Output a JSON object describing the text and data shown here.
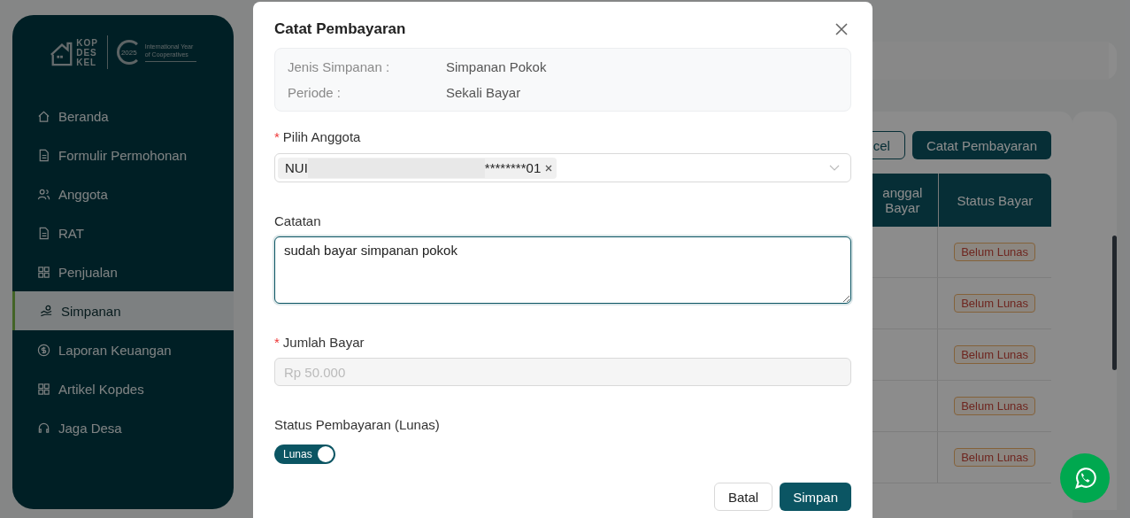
{
  "sidebar": {
    "logo": {
      "brand_lines": [
        "KOP",
        "DES",
        "KEL"
      ],
      "year": "2025",
      "caption": "International Year of Cooperatives"
    },
    "items": [
      {
        "label": "Beranda",
        "kind": "home",
        "selected": false
      },
      {
        "label": "Formulir Permohonan",
        "kind": "doc",
        "selected": false
      },
      {
        "label": "Anggota",
        "kind": "people",
        "selected": false
      },
      {
        "label": "RAT",
        "kind": "doc",
        "selected": false
      },
      {
        "label": "Penjualan",
        "kind": "grid",
        "selected": false
      },
      {
        "label": "Simpanan",
        "kind": "savings",
        "selected": true
      },
      {
        "label": "Laporan Keuangan",
        "kind": "dollar",
        "selected": false
      },
      {
        "label": "Artikel Kopdes",
        "kind": "grid",
        "selected": false
      },
      {
        "label": "Jaga Desa",
        "kind": "headset",
        "selected": false
      }
    ]
  },
  "toolbar": {
    "buttons": [
      {
        "label": "cel",
        "kind": "outline"
      },
      {
        "label": "Catat Pembayaran",
        "kind": "primary"
      }
    ]
  },
  "table": {
    "columns": [
      "anggal Bayar",
      "Status Bayar"
    ],
    "rows": [
      {
        "status": "Belum Lunas"
      },
      {
        "status": "Belum Lunas"
      },
      {
        "status": "Belum Lunas"
      },
      {
        "status": "Belum Lunas"
      },
      {
        "status": "Belum Lunas"
      }
    ]
  },
  "modal": {
    "title": "Catat Pembayaran",
    "info": [
      {
        "label": "Jenis Simpanan :",
        "value": "Simpanan Pokok"
      },
      {
        "label": "Periode :",
        "value": "Sekali Bayar"
      }
    ],
    "member": {
      "label": "Pilih Anggota",
      "required_mark": "*",
      "tag_start": "NUI",
      "tag_end": "********01"
    },
    "note": {
      "label": "Catatan",
      "value": "sudah bayar simpanan pokok"
    },
    "amount": {
      "label": "Jumlah Bayar",
      "required_mark": "*",
      "value": "Rp 50.000",
      "disabled": true
    },
    "status": {
      "label": "Status Pembayaran (Lunas)",
      "toggle_label": "Lunas",
      "on": true
    },
    "buttons": [
      {
        "label": "Batal",
        "kind": "outline"
      },
      {
        "label": "Simpan",
        "kind": "primary"
      }
    ]
  }
}
